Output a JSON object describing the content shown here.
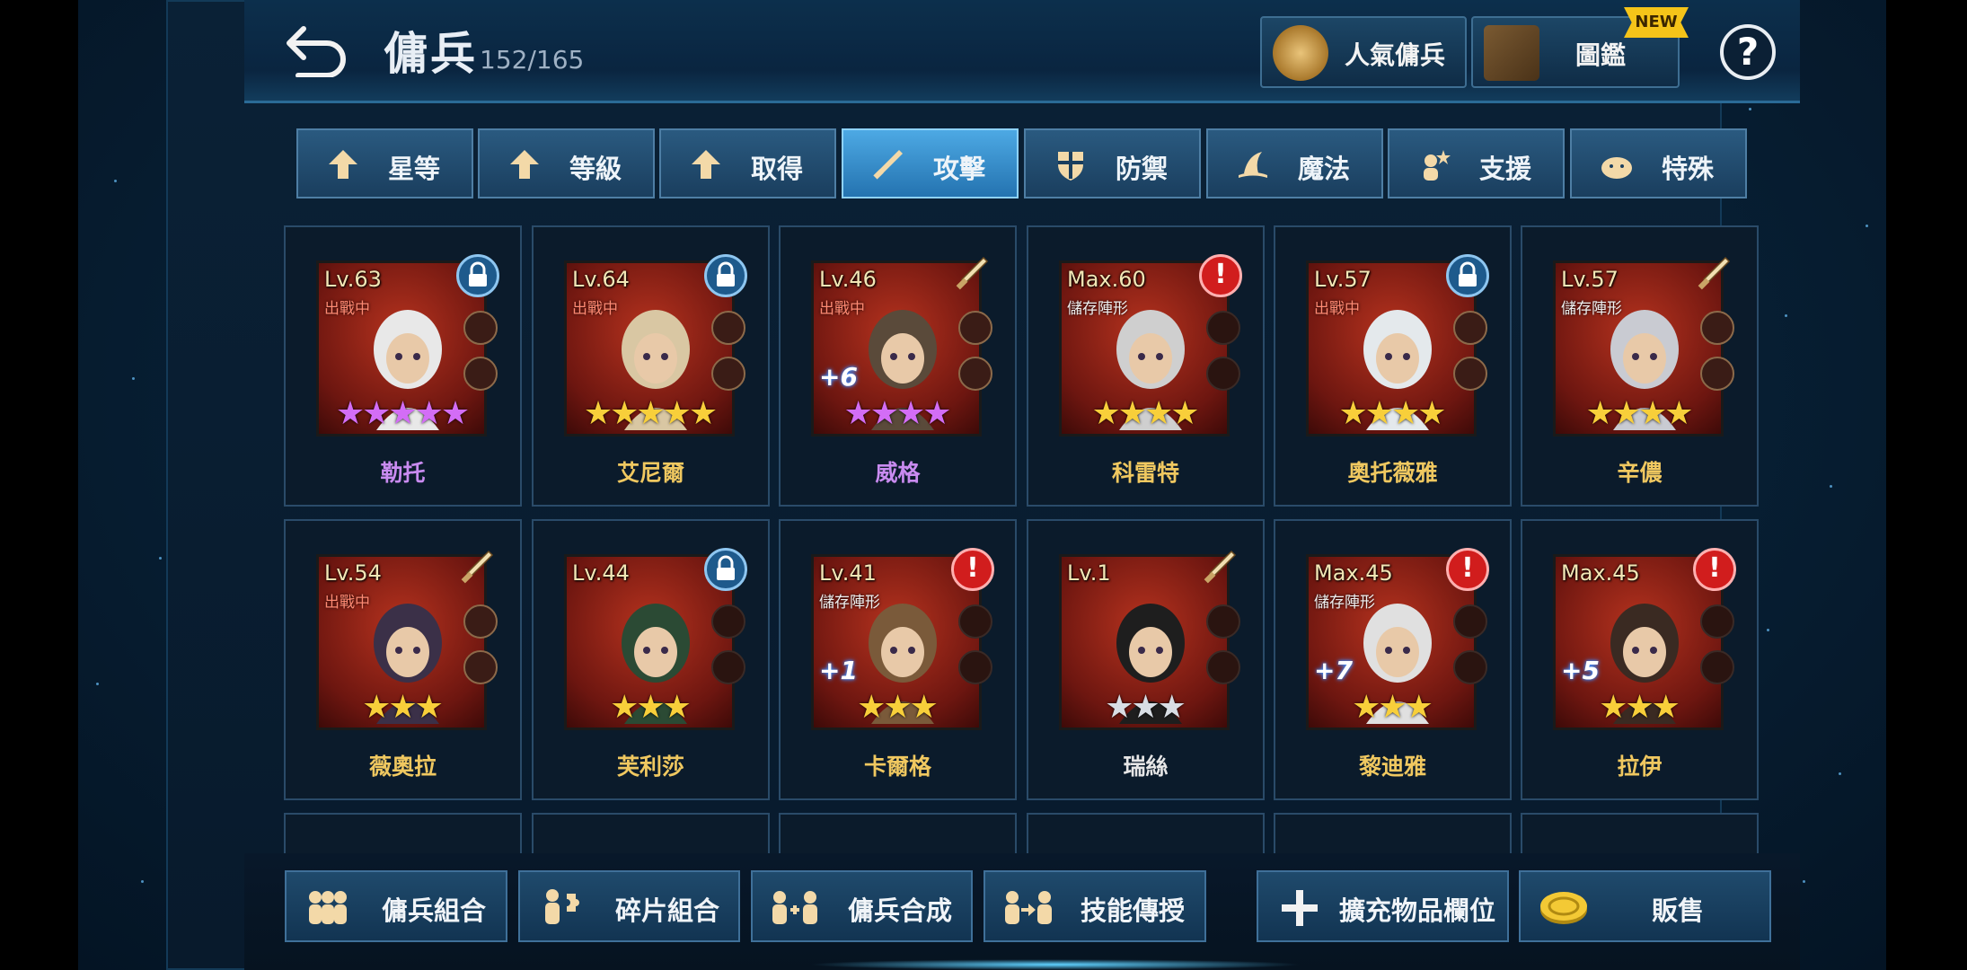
{
  "header": {
    "title": "傭兵",
    "count": "152/165",
    "popular_label": "人氣傭兵",
    "codex_label": "圖鑑",
    "new_badge": "NEW",
    "help_label": "?"
  },
  "tabs": [
    {
      "label": "星等",
      "icon": "arrow-up-icon",
      "active": false
    },
    {
      "label": "等級",
      "icon": "arrow-up-icon",
      "active": false
    },
    {
      "label": "取得",
      "icon": "arrow-up-icon",
      "active": false
    },
    {
      "label": "攻擊",
      "icon": "sword-icon",
      "active": true
    },
    {
      "label": "防禦",
      "icon": "shield-icon",
      "active": false
    },
    {
      "label": "魔法",
      "icon": "witch-hat-icon",
      "active": false
    },
    {
      "label": "支援",
      "icon": "support-icon",
      "active": false
    },
    {
      "label": "特殊",
      "icon": "blob-icon",
      "active": false
    }
  ],
  "cards": [
    {
      "level": "Lv.63",
      "status": "出戰中",
      "plus": "",
      "stars": 5,
      "star_color": "purple",
      "name": "勒托",
      "name_color": "#c98bf0",
      "corner": "lock"
    },
    {
      "level": "Lv.64",
      "status": "出戰中",
      "plus": "",
      "stars": 5,
      "star_color": "gold",
      "name": "艾尼爾",
      "name_color": "#f0c860",
      "corner": "lock"
    },
    {
      "level": "Lv.46",
      "status": "出戰中",
      "plus": "+6",
      "stars": 4,
      "star_color": "purple",
      "name": "威格",
      "name_color": "#c98bf0",
      "corner": "sword"
    },
    {
      "level": "Max.60",
      "status": "儲存陣形",
      "plus": "",
      "stars": 4,
      "star_color": "gold",
      "name": "科雷特",
      "name_color": "#f0c860",
      "corner": "alert"
    },
    {
      "level": "Lv.57",
      "status": "出戰中",
      "plus": "",
      "stars": 4,
      "star_color": "gold",
      "name": "奧托薇雅",
      "name_color": "#f0c860",
      "corner": "lock"
    },
    {
      "level": "Lv.57",
      "status": "儲存陣形",
      "plus": "",
      "stars": 4,
      "star_color": "gold",
      "name": "辛儂",
      "name_color": "#f0c860",
      "corner": "sword"
    },
    {
      "level": "Lv.54",
      "status": "出戰中",
      "plus": "",
      "stars": 3,
      "star_color": "gold",
      "name": "薇奧拉",
      "name_color": "#f0c860",
      "corner": "sword"
    },
    {
      "level": "Lv.44",
      "status": "",
      "plus": "",
      "stars": 3,
      "star_color": "gold",
      "name": "芙利莎",
      "name_color": "#f0c860",
      "corner": "lock"
    },
    {
      "level": "Lv.41",
      "status": "儲存陣形",
      "plus": "+1",
      "stars": 3,
      "star_color": "gold",
      "name": "卡爾格",
      "name_color": "#f0c860",
      "corner": "alert"
    },
    {
      "level": "Lv.1",
      "status": "",
      "plus": "",
      "stars": 3,
      "star_color": "silver",
      "name": "瑞絲",
      "name_color": "#e6e6e6",
      "corner": "sword"
    },
    {
      "level": "Max.45",
      "status": "儲存陣形",
      "plus": "+7",
      "stars": 3,
      "star_color": "gold",
      "name": "黎迪雅",
      "name_color": "#f0c860",
      "corner": "alert"
    },
    {
      "level": "Max.45",
      "status": "",
      "plus": "+5",
      "stars": 3,
      "star_color": "gold",
      "name": "拉伊",
      "name_color": "#f0c860",
      "corner": "alert"
    }
  ],
  "bottom": {
    "combine_label": "傭兵組合",
    "fragments_label": "碎片組合",
    "fuse_label": "傭兵合成",
    "skill_label": "技能傳授",
    "expand_label": "擴充物品欄位",
    "sell_label": "販售"
  },
  "colors": {
    "accent": "#4da9e4",
    "gold": "#f8cf3a",
    "purple": "#d36df6"
  }
}
